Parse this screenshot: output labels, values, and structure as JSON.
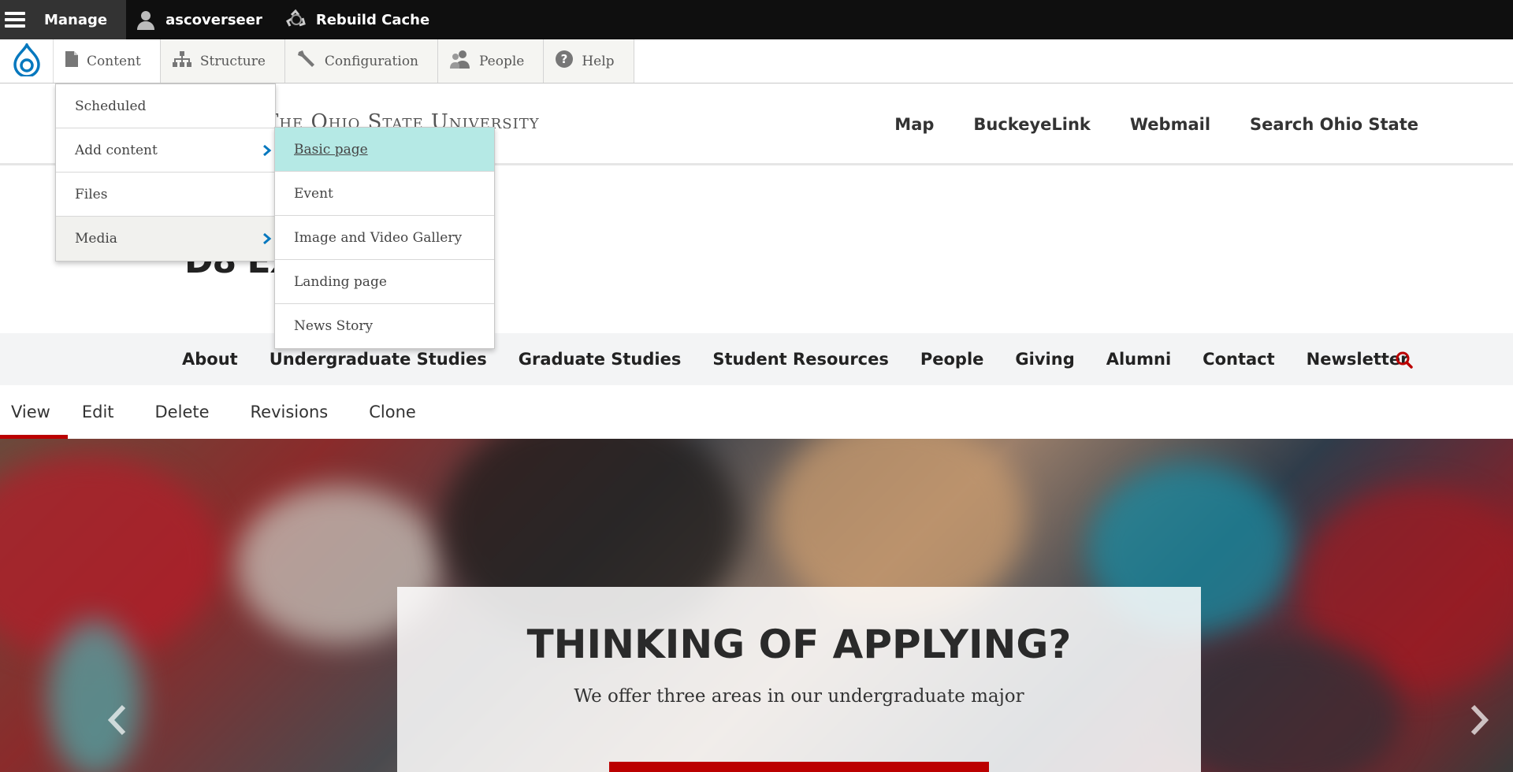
{
  "admin_bar": {
    "manage": "Manage",
    "user": "ascoverseer",
    "rebuild": "Rebuild Cache"
  },
  "tray": {
    "items": [
      {
        "label": "Content",
        "icon": "page-icon"
      },
      {
        "label": "Structure",
        "icon": "sitemap-icon"
      },
      {
        "label": "Configuration",
        "icon": "wrench-icon"
      },
      {
        "label": "People",
        "icon": "people-icon"
      },
      {
        "label": "Help",
        "icon": "help-icon"
      }
    ]
  },
  "content_menu": {
    "items": [
      "Scheduled",
      "Add content",
      "Files",
      "Media"
    ]
  },
  "add_content_menu": {
    "items": [
      "Basic page",
      "Event",
      "Image and Video Gallery",
      "Landing page",
      "News Story"
    ]
  },
  "site_header": {
    "wordmark": "The Ohio State University",
    "utility_links": [
      "Map",
      "BuckeyeLink",
      "Webmail",
      "Search Ohio State"
    ],
    "site_title": "D8 Ex"
  },
  "main_nav": {
    "items": [
      "About",
      "Undergraduate Studies",
      "Graduate Studies",
      "Student Resources",
      "People",
      "Giving",
      "Alumni",
      "Contact",
      "Newsletter"
    ]
  },
  "tabs": [
    "View",
    "Edit",
    "Delete",
    "Revisions",
    "Clone"
  ],
  "hero": {
    "heading": "THINKING OF APPLYING?",
    "subtext": "We offer three areas in our undergraduate major"
  },
  "colors": {
    "osu_red": "#bb0000",
    "highlight": "#b5e9e5",
    "drupal_blue": "#0678be"
  }
}
